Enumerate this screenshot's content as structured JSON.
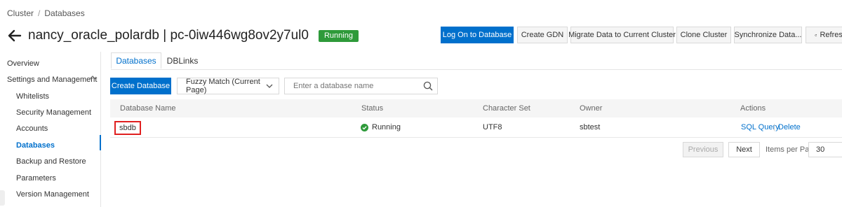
{
  "breadcrumb": {
    "items": [
      "Cluster",
      "Databases"
    ],
    "separator": "/"
  },
  "header": {
    "title": "nancy_oracle_polardb | pc-0iw446wg8ov2y7ul0",
    "status": "Running"
  },
  "toolbar": {
    "log_on": "Log On to Database",
    "create_gdn": "Create GDN",
    "migrate": "Migrate Data to Current Cluster",
    "clone": "Clone Cluster",
    "sync": "Synchronize Data...",
    "refresh": "Refresh"
  },
  "sidebar": {
    "overview": "Overview",
    "settings_group": "Settings and Management",
    "items": [
      "Whitelists",
      "Security Management",
      "Accounts",
      "Databases",
      "Backup and Restore",
      "Parameters",
      "Version Management"
    ]
  },
  "tabs": [
    "Databases",
    "DBLinks"
  ],
  "controls": {
    "create_db": "Create Database",
    "match_mode": "Fuzzy Match (Current Page)",
    "search_placeholder": "Enter a database name"
  },
  "table": {
    "headers": [
      "Database Name",
      "Status",
      "Character Set",
      "Owner",
      "Actions"
    ],
    "rows": [
      {
        "name": "sbdb",
        "status": "Running",
        "charset": "UTF8",
        "owner": "sbtest",
        "action_sql": "SQL Query",
        "action_delete": "Delete"
      }
    ]
  },
  "pagination": {
    "previous": "Previous",
    "next": "Next",
    "items_per_page_label": "Items per Page:",
    "items_per_page": "30"
  },
  "colors": {
    "accent": "#0070cc",
    "running": "#2e9a3a",
    "highlight_box": "#e02020"
  }
}
